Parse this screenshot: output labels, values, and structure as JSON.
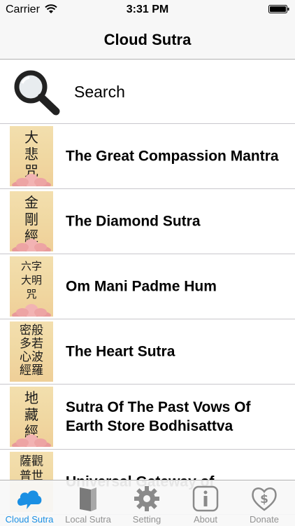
{
  "status_bar": {
    "carrier": "Carrier",
    "time": "3:31 PM"
  },
  "nav": {
    "title": "Cloud Sutra"
  },
  "search": {
    "label": "Search"
  },
  "items": [
    {
      "thumb": "大\n悲\n咒",
      "label": "The Great Compassion Mantra"
    },
    {
      "thumb": "金\n剛\n經",
      "label": "The Diamond Sutra"
    },
    {
      "thumb": "六字\n大明\n咒",
      "label": "Om Mani Padme Hum"
    },
    {
      "thumb": "密般\n多若\n心波\n經羅",
      "label": "The Heart Sutra"
    },
    {
      "thumb": "地\n藏\n經",
      "label": "Sutra Of The Past Vows Of Earth Store Bodhisattva"
    },
    {
      "thumb": "薩觀\n普世",
      "label": "Universal Gateway of"
    }
  ],
  "tabs": [
    {
      "label": "Cloud Sutra",
      "icon": "cloud-icon",
      "active": true
    },
    {
      "label": "Local Sutra",
      "icon": "book-icon",
      "active": false
    },
    {
      "label": "Setting",
      "icon": "gear-icon",
      "active": false
    },
    {
      "label": "About",
      "icon": "info-icon",
      "active": false
    },
    {
      "label": "Donate",
      "icon": "heart-dollar-icon",
      "active": false
    }
  ],
  "colors": {
    "accent": "#1a8fe3",
    "tab_inactive": "#929292"
  }
}
